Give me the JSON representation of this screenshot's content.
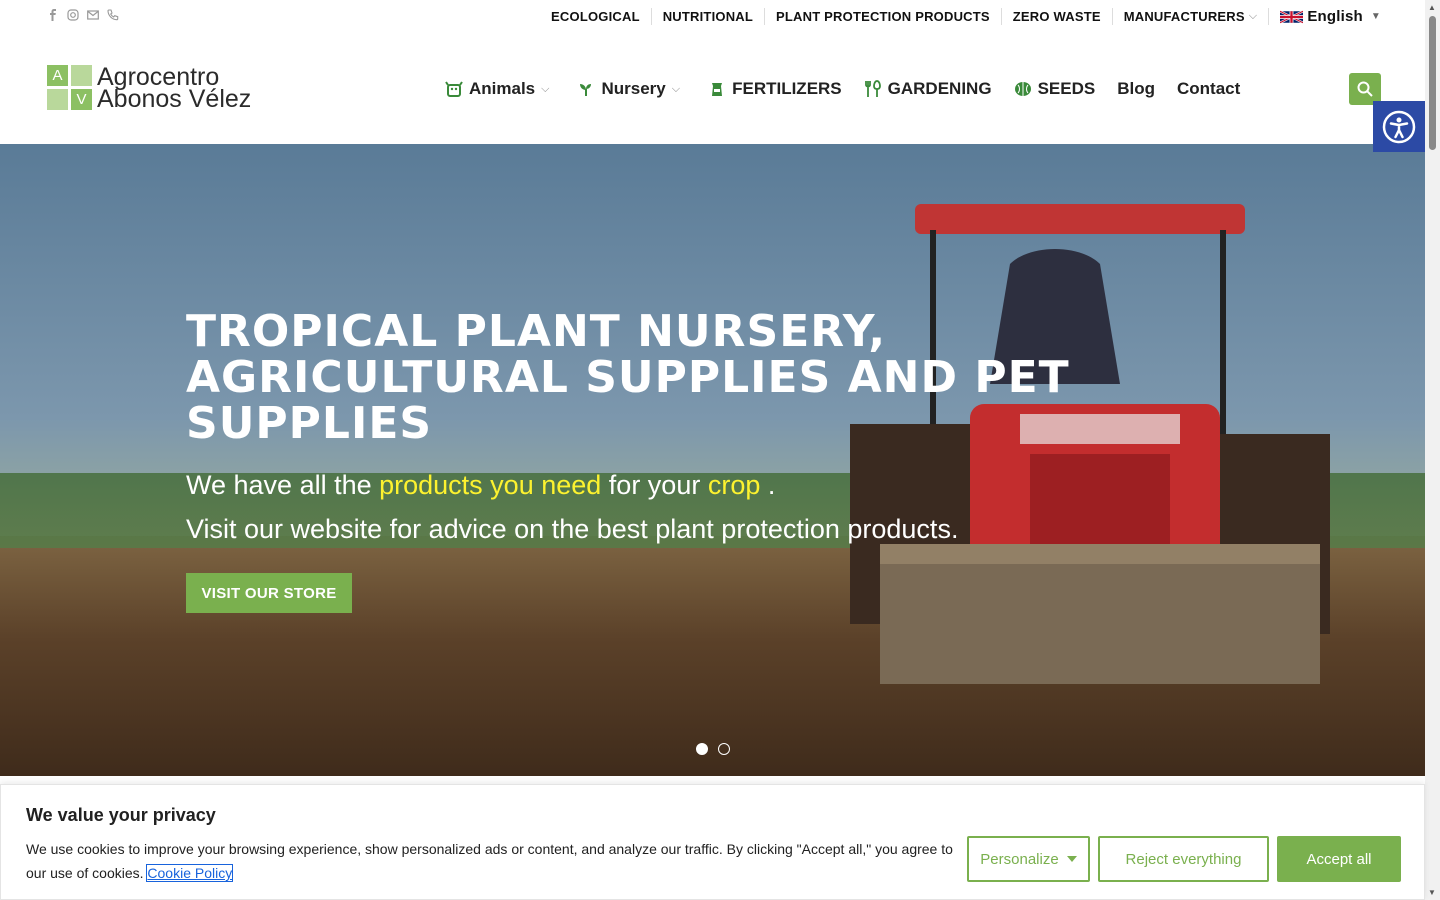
{
  "topbar": {
    "social_icons": [
      "facebook-icon",
      "instagram-icon",
      "mail-icon",
      "phone-icon"
    ],
    "nav": [
      {
        "label": "ECOLOGICAL"
      },
      {
        "label": "NUTRITIONAL"
      },
      {
        "label": "PLANT PROTECTION PRODUCTS"
      },
      {
        "label": "ZERO WASTE"
      },
      {
        "label": "MANUFACTURERS",
        "has_dropdown": true
      }
    ],
    "language": {
      "label": "English",
      "caret": "▼",
      "flag": "uk-flag-icon"
    }
  },
  "header": {
    "logo": {
      "mark": [
        "A",
        "",
        "",
        "V"
      ],
      "line1": "Agrocentro",
      "line2": "Abonos Vélez"
    },
    "nav": [
      {
        "label": "Animals",
        "icon": "animals-icon",
        "dropdown": true
      },
      {
        "label": "Nursery",
        "icon": "sprout-icon",
        "dropdown": true
      },
      {
        "label": "FERTILIZERS",
        "icon": "fertilizer-bag-icon"
      },
      {
        "label": "GARDENING",
        "icon": "garden-tools-icon"
      },
      {
        "label": "SEEDS",
        "icon": "seed-icon"
      },
      {
        "label": "Blog"
      },
      {
        "label": "Contact"
      }
    ],
    "chevron": "⌵"
  },
  "hero": {
    "title": "TROPICAL PLANT NURSERY, AGRICULTURAL SUPPLIES AND PET SUPPLIES",
    "sub1_a": "We have all the ",
    "sub1_hl1": "products you need",
    "sub1_b": " for your ",
    "sub1_hl2": "crop",
    "sub1_c": " .",
    "sub2": "Visit our website for advice on the best plant protection products.",
    "cta": "VISIT OUR STORE",
    "slides": 2,
    "active_slide": 1
  },
  "cookie": {
    "title": "We value your privacy",
    "text": "We use cookies to improve your browsing experience, show personalized ads or content, and analyze our traffic. By clicking \"Accept all,\" you agree to our use of cookies. ",
    "link": "Cookie Policy",
    "personalize": "Personalize",
    "reject": "Reject everything",
    "accept": "Accept all"
  },
  "colors": {
    "brand_green": "#7ab04e",
    "highlight_yellow": "#fdf22f",
    "a11y_blue": "#2c4aa5",
    "link_blue": "#1863dc"
  }
}
